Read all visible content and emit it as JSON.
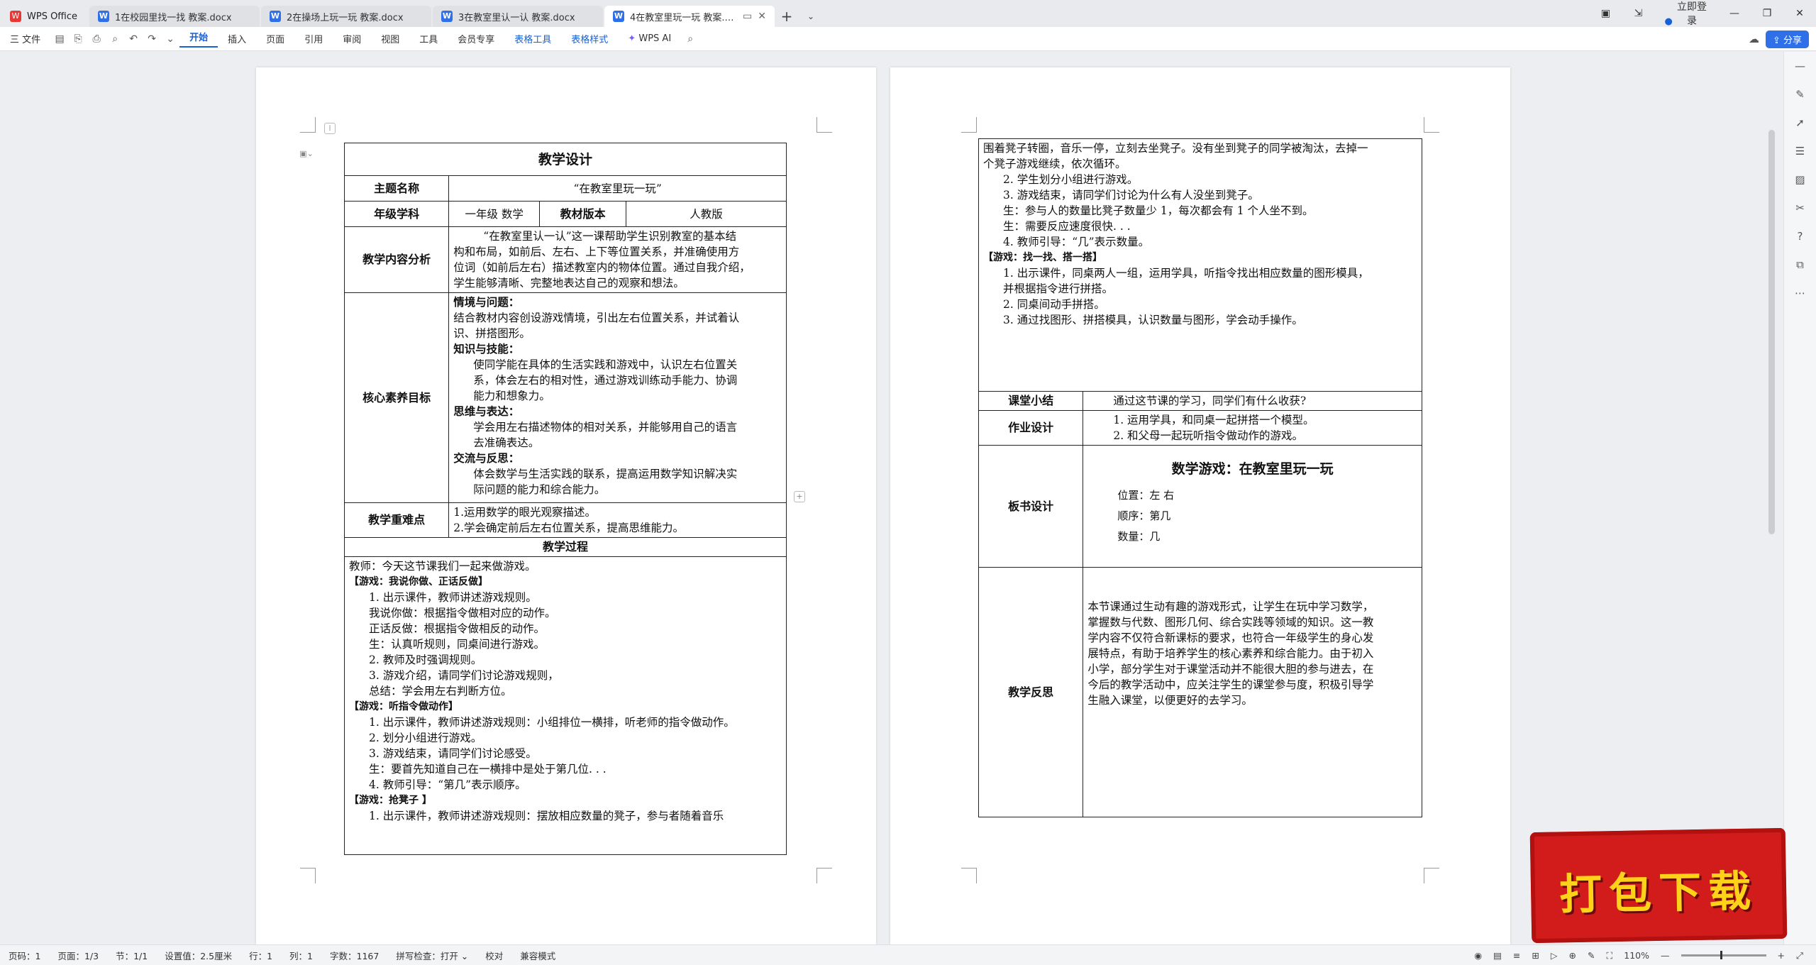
{
  "tabs": [
    {
      "label": "WPS Office"
    },
    {
      "label": "1在校园里找一找 教案.docx"
    },
    {
      "label": "2在操场上玩一玩 教案.docx"
    },
    {
      "label": "3在教室里认一认 教案.docx"
    },
    {
      "label": "4在教室里玩一玩 教案.docx"
    }
  ],
  "login": "立即登录",
  "toolbar": {
    "file": "三 文件",
    "menus": [
      "开始",
      "插入",
      "页面",
      "引用",
      "审阅",
      "视图",
      "工具",
      "会员专享",
      "表格工具",
      "表格样式"
    ],
    "wps_ai": "WPS AI",
    "share": "分享"
  },
  "page1": {
    "title": "教学设计",
    "topic_label": "主题名称",
    "topic_value": "“在教室里玩一玩”",
    "grade_label": "年级学科",
    "grade_value": "一年级 数学",
    "edition_label": "教材版本",
    "edition_value": "人教版",
    "analysis_label": "教学内容分析",
    "analysis_lines": [
      "“在教室里认一认”这一课帮助学生识别教室的基本结",
      "构和布局，如前后、左右、上下等位置关系，并准确使用方",
      "位词（如前后左右）描述教室内的物体位置。通过自我介绍，",
      "学生能够清晰、完整地表达自己的观察和想法。"
    ],
    "core_label": "核心素养目标",
    "core_sections": [
      {
        "head": "情境与问题：",
        "lines": [
          "结合教材内容创设游戏情境，引出左右位置关系，并试着认",
          "识、拼搭图形。"
        ],
        "indent": false
      },
      {
        "head": "知识与技能：",
        "lines": [
          "使同学能在具体的生活实践和游戏中，认识左右位置关",
          "系，体会左右的相对性，通过游戏训练动手能力、协调",
          "能力和想象力。"
        ],
        "indent": true
      },
      {
        "head": "思维与表达：",
        "lines": [
          "学会用左右描述物体的相对关系，并能够用自己的语言",
          "去准确表达。"
        ],
        "indent": true
      },
      {
        "head": "交流与反思：",
        "lines": [
          "体会数学与生活实践的联系，提高运用数学知识解决实",
          "际问题的能力和综合能力。"
        ],
        "indent": true
      }
    ],
    "key_label": "教学重难点",
    "key_lines": [
      "1.运用数学的眼光观察描述。",
      "2.学会确定前后左右位置关系，提高思维能力。"
    ],
    "process_label": "教学过程",
    "process_lines": [
      {
        "t": "教师：今天这节课我们一起来做游戏。",
        "c": ""
      },
      {
        "t": "【游戏：我说你做、正话反做】",
        "c": "small-bold"
      },
      {
        "t": "1. 出示课件，教师讲述游戏规则。",
        "c": "in1"
      },
      {
        "t": "我说你做：根据指令做相对应的动作。",
        "c": "in1"
      },
      {
        "t": "正话反做：根据指令做相反的动作。",
        "c": "in1"
      },
      {
        "t": "生：认真听规则，同桌间进行游戏。",
        "c": "in1"
      },
      {
        "t": "2. 教师及时强调规则。",
        "c": "in1"
      },
      {
        "t": "3. 游戏介绍，请同学们讨论游戏规则，",
        "c": "in1"
      },
      {
        "t": "总结：学会用左右判断方位。",
        "c": "in1"
      },
      {
        "t": "【游戏：听指令做动作】",
        "c": "small-bold"
      },
      {
        "t": "1. 出示课件，教师讲述游戏规则：小组排位一横排，听老师的指令做动作。",
        "c": "in1"
      },
      {
        "t": "2. 划分小组进行游戏。",
        "c": "in1"
      },
      {
        "t": "3. 游戏结束，请同学们讨论感受。",
        "c": "in1"
      },
      {
        "t": "生：要首先知道自己在一横排中是处于第几位. . .",
        "c": "in1"
      },
      {
        "t": "4. 教师引导：“第几”表示顺序。",
        "c": "in1"
      },
      {
        "t": "【游戏：抢凳子 】",
        "c": "small-bold"
      },
      {
        "t": "1. 出示课件，教师讲述游戏规则：摆放相应数量的凳子，参与者随着音乐",
        "c": "in1"
      }
    ]
  },
  "page2": {
    "process_lines": [
      {
        "t": "围着凳子转圈，音乐一停，立刻去坐凳子。没有坐到凳子的同学被淘汰，去掉一",
        "c": ""
      },
      {
        "t": "个凳子游戏继续，依次循环。",
        "c": ""
      },
      {
        "t": "2. 学生划分小组进行游戏。",
        "c": "in1"
      },
      {
        "t": "3. 游戏结束，请同学们讨论为什么有人没坐到凳子。",
        "c": "in1"
      },
      {
        "t": "生：参与人的数量比凳子数量少 1，每次都会有 1 个人坐不到。",
        "c": "in1"
      },
      {
        "t": "生：需要反应速度很快. . .",
        "c": "in1"
      },
      {
        "t": "4. 教师引导：“几”表示数量。",
        "c": "in1"
      },
      {
        "t": "【游戏：找一找、搭一搭】",
        "c": "small-bold"
      },
      {
        "t": "1. 出示课件，同桌两人一组，运用学具，听指令找出相应数量的图形模具，",
        "c": "in1"
      },
      {
        "t": "并根据指令进行拼搭。",
        "c": "in1"
      },
      {
        "t": "2. 同桌间动手拼搭。",
        "c": "in1"
      },
      {
        "t": "3. 通过找图形、拼搭模具，认识数量与图形，学会动手操作。",
        "c": "in1"
      }
    ],
    "summary_label": "课堂小结",
    "summary_value": "通过这节课的学习，同学们有什么收获?",
    "homework_label": "作业设计",
    "homework_lines": [
      "1. 运用学具，和同桌一起拼搭一个模型。",
      "2. 和父母一起玩听指令做动作的游戏。"
    ],
    "board_label": "板书设计",
    "board_title": "数学游戏：在教室里玩一玩",
    "board_lines": [
      "位置：左  右",
      "顺序：第几",
      "数量：几"
    ],
    "reflect_label": "教学反思",
    "reflect_lines": [
      "本节课通过生动有趣的游戏形式，让学生在玩中学习数学，",
      "掌握数与代数、图形几何、综合实践等领域的知识。这一教",
      "学内容不仅符合新课标的要求，也符合一年级学生的身心发",
      "展特点，有助于培养学生的核心素养和综合能力。由于初入",
      "小学，部分学生对于课堂活动并不能很大胆的参与进去，在",
      "今后的教学活动中，应关注学生的课堂参与度，积极引导学",
      "生融入课堂，以便更好的去学习。"
    ]
  },
  "status": {
    "items": [
      "页码：1",
      "页面：1/3",
      "节：1/1",
      "设置值：2.5厘米",
      "行：1",
      "列：1",
      "字数：1167",
      "拼写检查：打开 ⌄",
      "校对",
      "兼容模式"
    ],
    "zoom": "110%"
  },
  "promo": {
    "text": "打包下载"
  },
  "colors": {
    "accent": "#1a5fd3",
    "promo": "#d21c1c",
    "promo_text": "#ffd21a"
  }
}
